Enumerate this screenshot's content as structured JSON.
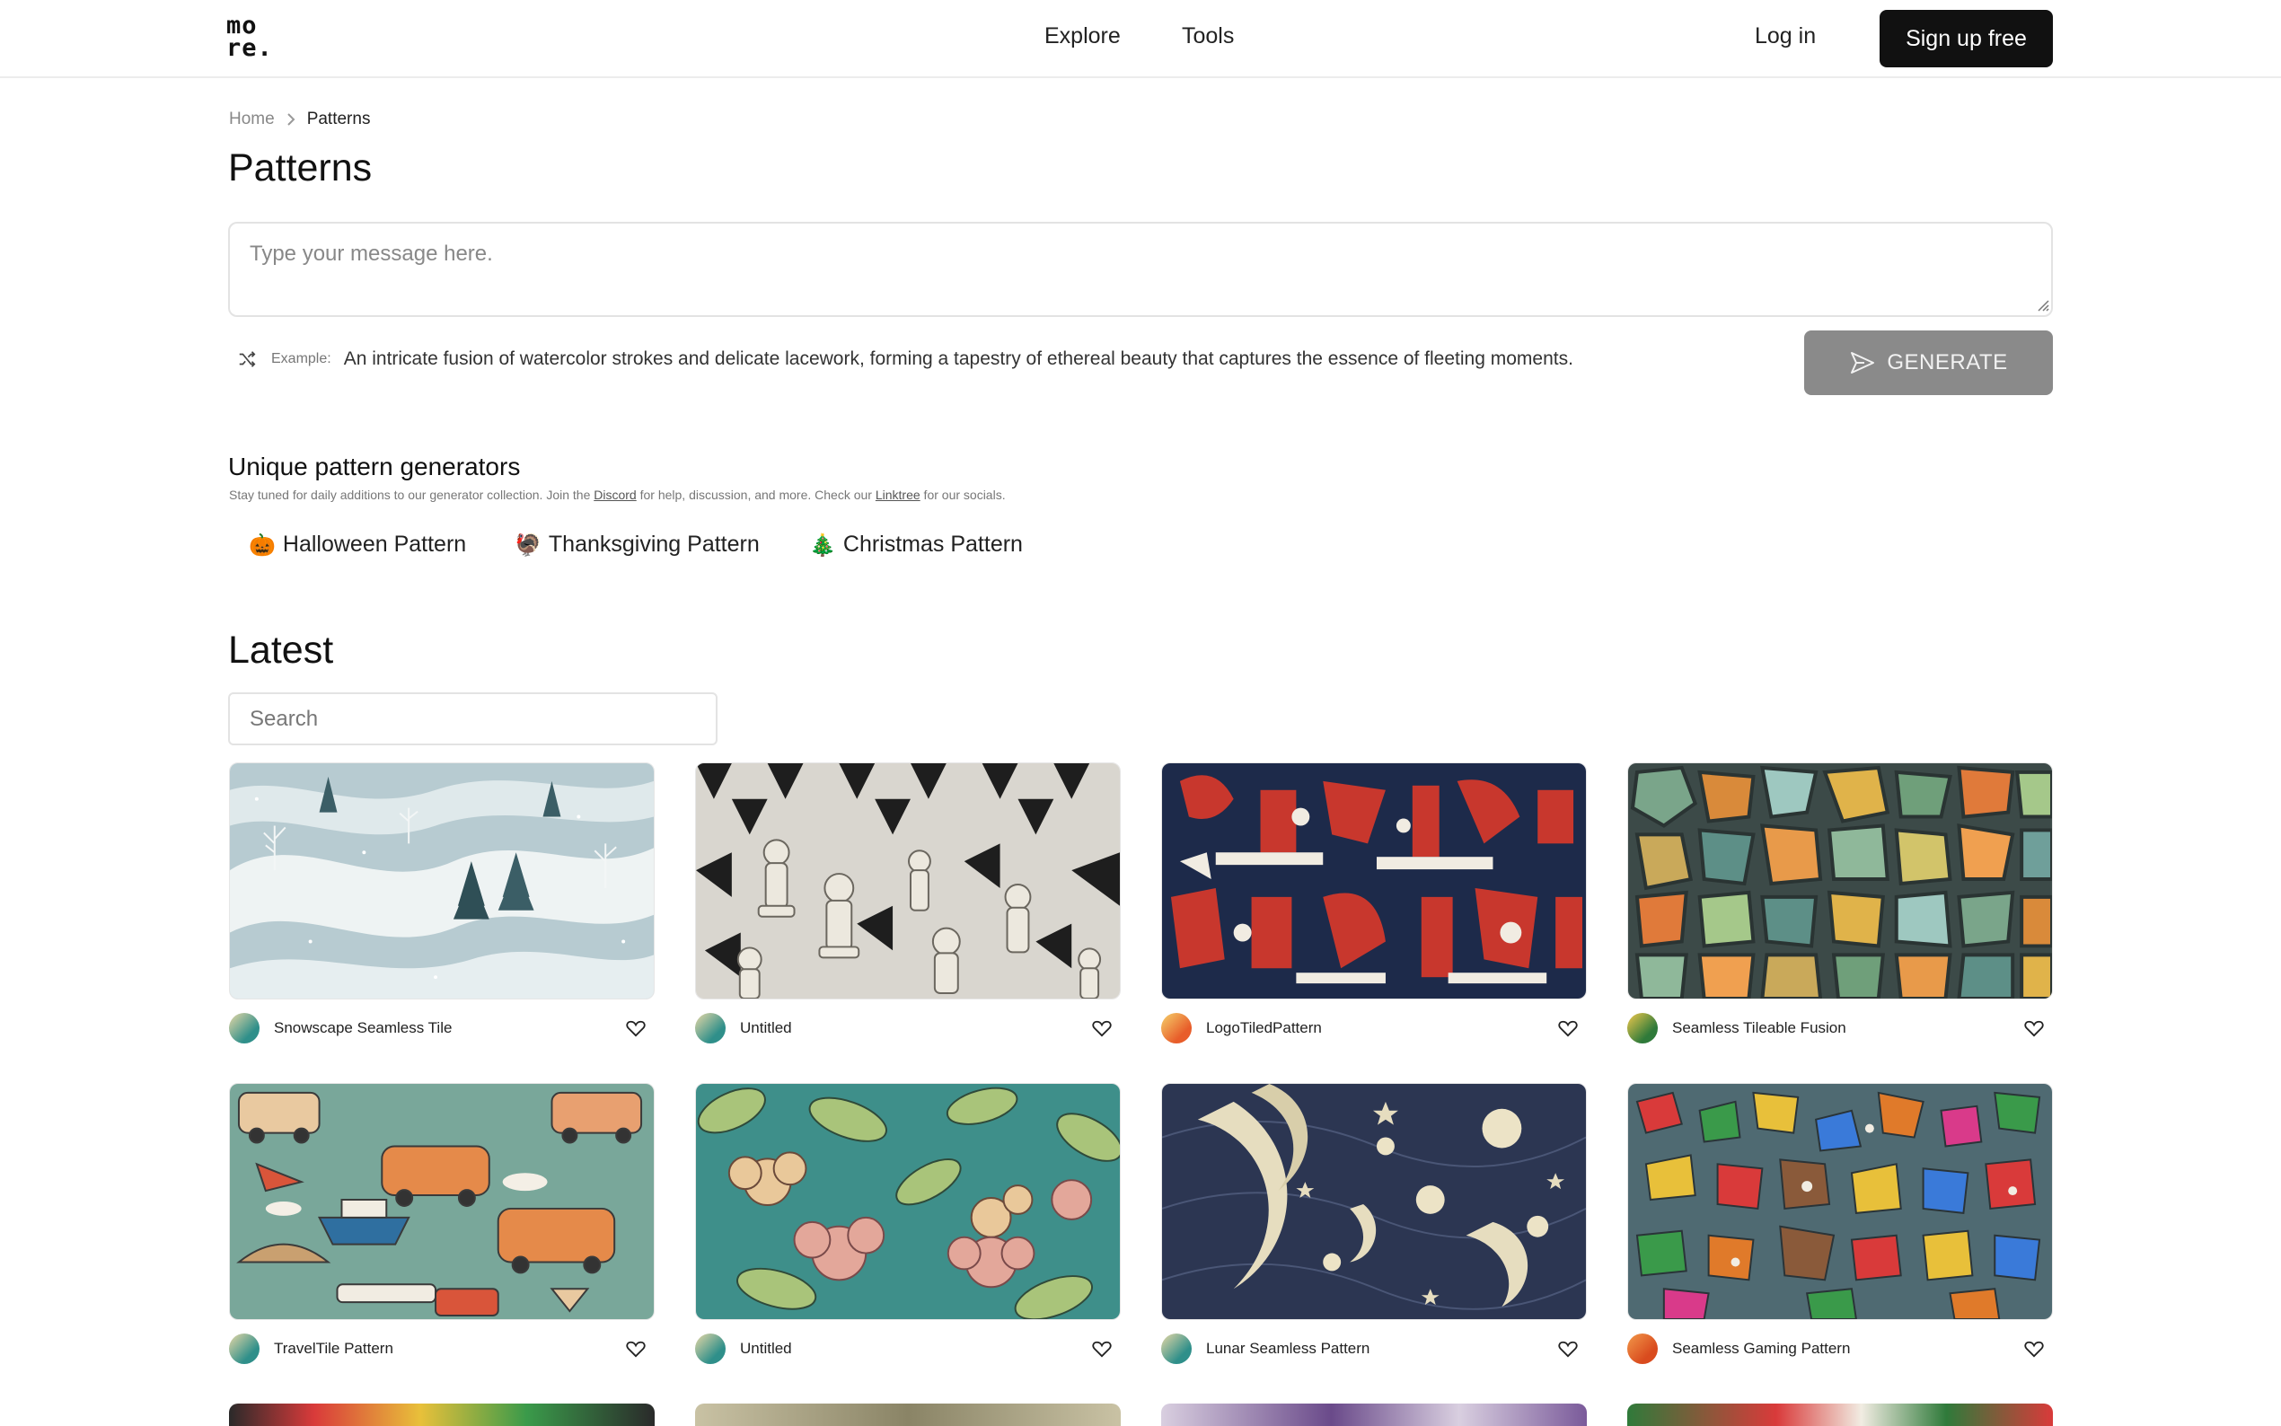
{
  "header": {
    "logo_line1": "mo",
    "logo_line2": "re.",
    "nav": [
      "Explore",
      "Tools"
    ],
    "login_label": "Log in",
    "signup_label": "Sign up free"
  },
  "breadcrumb": {
    "home": "Home",
    "current": "Patterns"
  },
  "page_title": "Patterns",
  "prompt": {
    "placeholder": "Type your message here."
  },
  "example": {
    "label": "Example:",
    "text": "An intricate fusion of watercolor strokes and delicate lacework, forming a tapestry of ethereal beauty that captures the essence of fleeting moments."
  },
  "generate_label": "GENERATE",
  "generators": {
    "title": "Unique pattern generators",
    "desc_1": "Stay tuned for daily additions to our generator collection. Join the ",
    "desc_link1": "Discord",
    "desc_2": " for help, discussion, and more. Check our ",
    "desc_link2": "Linktree",
    "desc_3": " for our socials.",
    "items": [
      {
        "emoji": "🎃",
        "label": "Halloween Pattern"
      },
      {
        "emoji": "🦃",
        "label": "Thanksgiving Pattern"
      },
      {
        "emoji": "🎄",
        "label": "Christmas Pattern"
      }
    ]
  },
  "latest": {
    "title": "Latest",
    "search_placeholder": "Search",
    "cards": [
      {
        "name": "Snowscape Seamless Tile",
        "avatar_colors": [
          "#2f8f8a",
          "#e9d8a6"
        ]
      },
      {
        "name": "Untitled",
        "avatar_colors": [
          "#2f8f8a",
          "#e9d8a6"
        ]
      },
      {
        "name": "LogoTiledPattern",
        "avatar_colors": [
          "#e85d2a",
          "#f5d26b"
        ]
      },
      {
        "name": "Seamless Tileable Fusion",
        "avatar_colors": [
          "#2f7a3a",
          "#f2c94c"
        ]
      },
      {
        "name": "TravelTile Pattern",
        "avatar_colors": [
          "#2f8f8a",
          "#e9d8a6"
        ]
      },
      {
        "name": "Untitled",
        "avatar_colors": [
          "#2f8f8a",
          "#e9d8a6"
        ]
      },
      {
        "name": "Lunar Seamless Pattern",
        "avatar_colors": [
          "#2f8f8a",
          "#e9d8a6"
        ]
      },
      {
        "name": "Seamless Gaming Pattern",
        "avatar_colors": [
          "#d94b1e",
          "#f2994a"
        ]
      }
    ]
  },
  "icons": {
    "shuffle": "shuffle-icon",
    "send": "send-icon",
    "heart": "heart-icon",
    "chevron": "chevron-right-icon"
  }
}
